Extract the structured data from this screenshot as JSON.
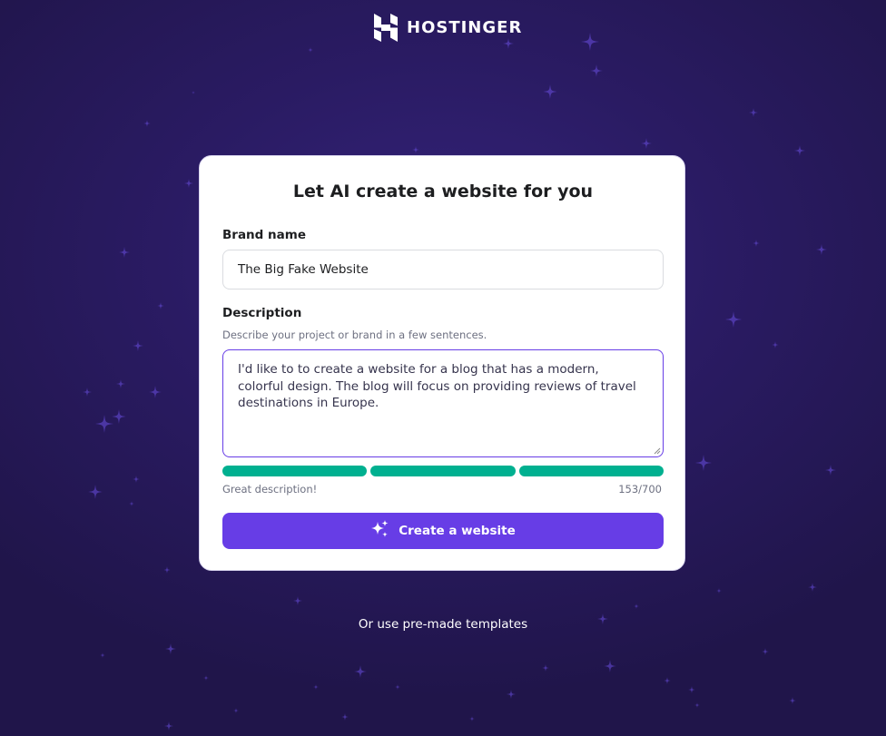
{
  "brand": {
    "logo_text": "HOSTINGER",
    "logo_icon": "hostinger-h-logo"
  },
  "form": {
    "title": "Let AI create a website for you",
    "brand_name_label": "Brand name",
    "brand_name_value": "The Big Fake Website",
    "description_label": "Description",
    "description_hint": "Describe your project or brand in a few sentences.",
    "description_value": "I'd like to to create a website for a blog that has a modern, colorful design. The blog will focus on providing reviews of travel destinations in Europe.",
    "quality_text": "Great description!",
    "quality_segments_filled": 3,
    "quality_segments_total": 3,
    "char_count": "153/700",
    "submit_label": "Create a website",
    "submit_icon": "sparkles-icon"
  },
  "footer": {
    "templates_link": "Or use pre-made templates"
  },
  "colors": {
    "background": "#2a1b63",
    "accent": "#673de6",
    "success": "#00b090",
    "card": "#ffffff"
  }
}
